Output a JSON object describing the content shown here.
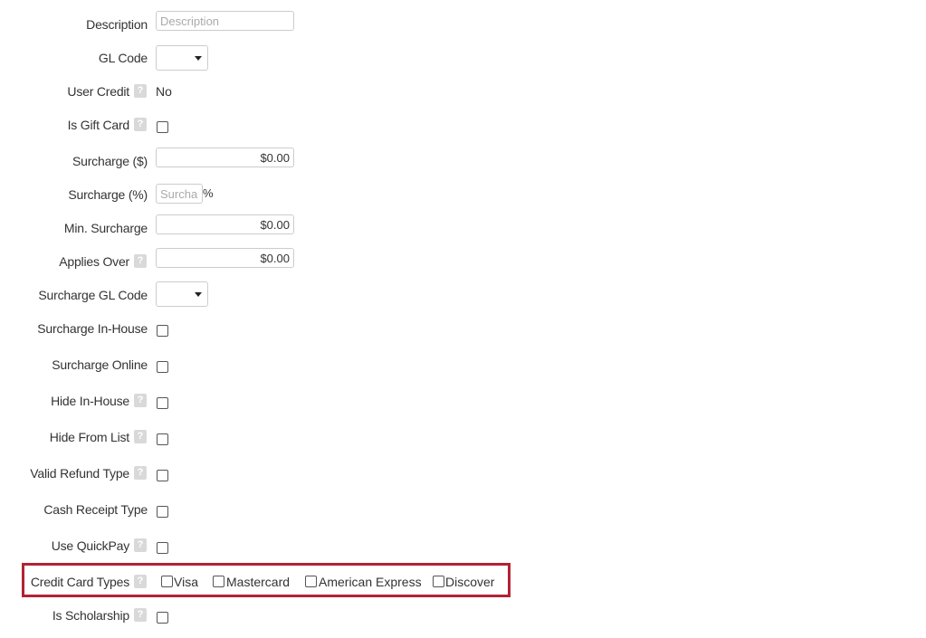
{
  "form": {
    "description": {
      "label": "Description",
      "placeholder": "Description",
      "value": ""
    },
    "gl_code": {
      "label": "GL Code",
      "value": ""
    },
    "user_credit": {
      "label": "User Credit",
      "value": "No"
    },
    "is_gift_card": {
      "label": "Is Gift Card",
      "checked": false
    },
    "surcharge_amount": {
      "label": "Surcharge ($)",
      "value": "$0.00"
    },
    "surcharge_percent": {
      "label": "Surcharge (%)",
      "placeholder": "Surcharge",
      "suffix": "%"
    },
    "min_surcharge": {
      "label": "Min. Surcharge",
      "value": "$0.00"
    },
    "applies_over": {
      "label": "Applies Over",
      "value": "$0.00"
    },
    "surcharge_gl_code": {
      "label": "Surcharge GL Code",
      "value": ""
    },
    "surcharge_in_house": {
      "label": "Surcharge In-House",
      "checked": false
    },
    "surcharge_online": {
      "label": "Surcharge Online",
      "checked": false
    },
    "hide_in_house": {
      "label": "Hide In-House",
      "checked": false
    },
    "hide_from_list": {
      "label": "Hide From List",
      "checked": false
    },
    "valid_refund_type": {
      "label": "Valid Refund Type",
      "checked": false
    },
    "cash_receipt_type": {
      "label": "Cash Receipt Type",
      "checked": false
    },
    "use_quickpay": {
      "label": "Use QuickPay",
      "checked": false
    },
    "credit_card_types": {
      "label": "Credit Card Types",
      "options": [
        "Visa",
        "Mastercard",
        "American Express",
        "Discover"
      ]
    },
    "is_scholarship": {
      "label": "Is Scholarship",
      "checked": false
    }
  },
  "help_glyph": "?",
  "highlight_color": "#b22234"
}
